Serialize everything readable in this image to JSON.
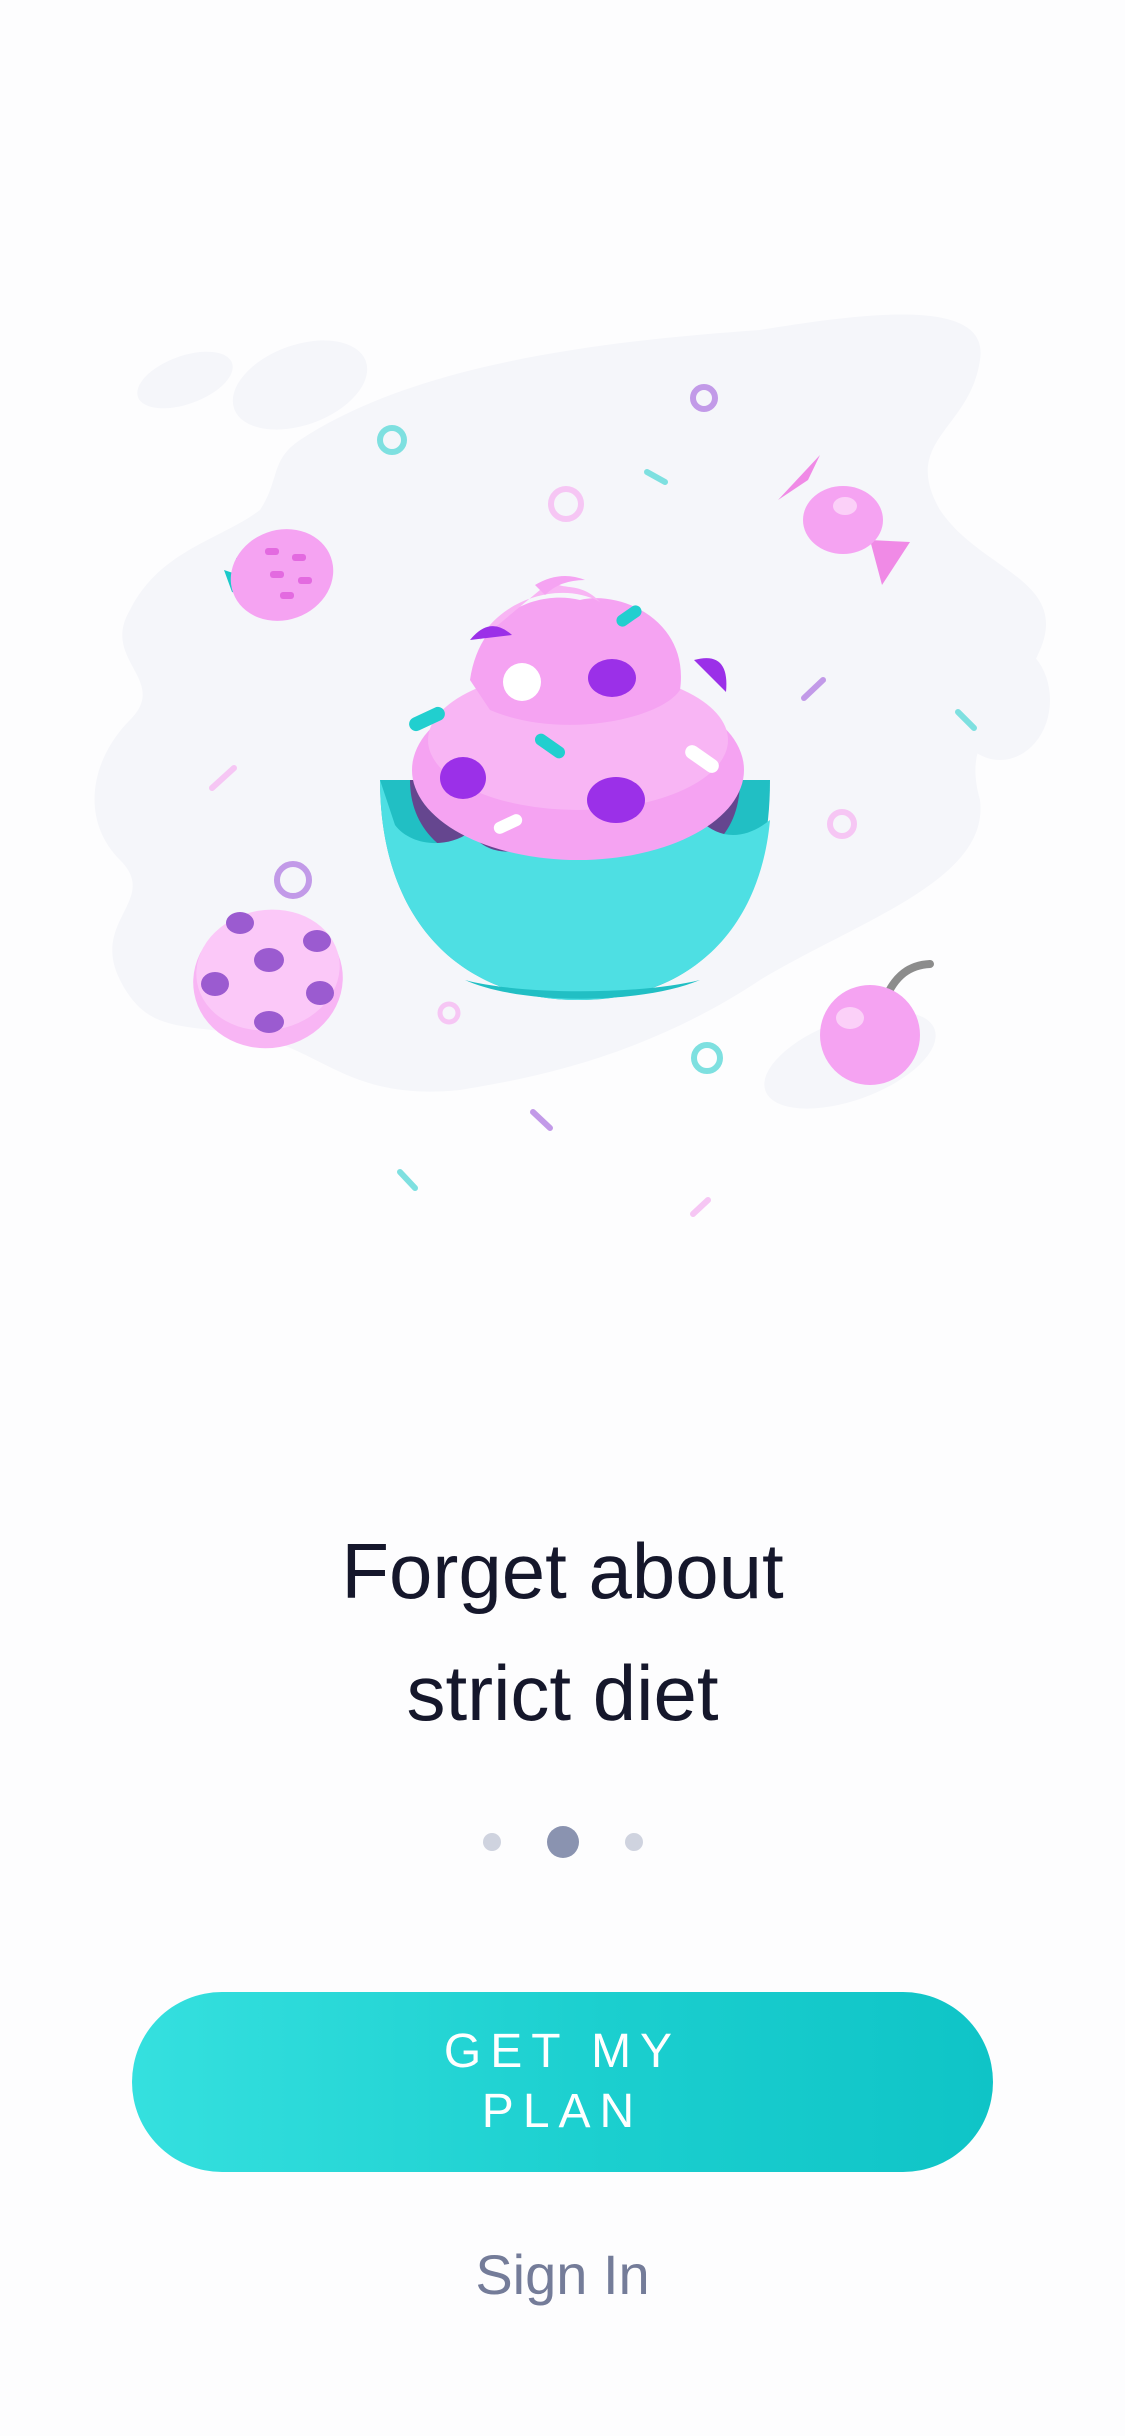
{
  "onboarding": {
    "headline_line1": "Forget about",
    "headline_line2": "strict diet",
    "page_count": 3,
    "current_page": 2,
    "cta_line1": "GET MY",
    "cta_line2": "PLAN",
    "signin_label": "Sign In"
  },
  "illustration": {
    "subject": "cupcake-illustration",
    "items": [
      "cupcake-icon",
      "strawberry-icon",
      "candy-icon",
      "cookie-icon",
      "cherry-icon",
      "sprinkle-icon",
      "ring-icon"
    ]
  },
  "colors": {
    "accent_teal": "#1bcfcf",
    "headline": "#15172b",
    "muted_text": "#747c99",
    "dot_active": "#8a93b0",
    "dot_inactive": "#cfd3df",
    "frosting_pink": "#f5a3f2",
    "berry_purple": "#9b30e8"
  }
}
